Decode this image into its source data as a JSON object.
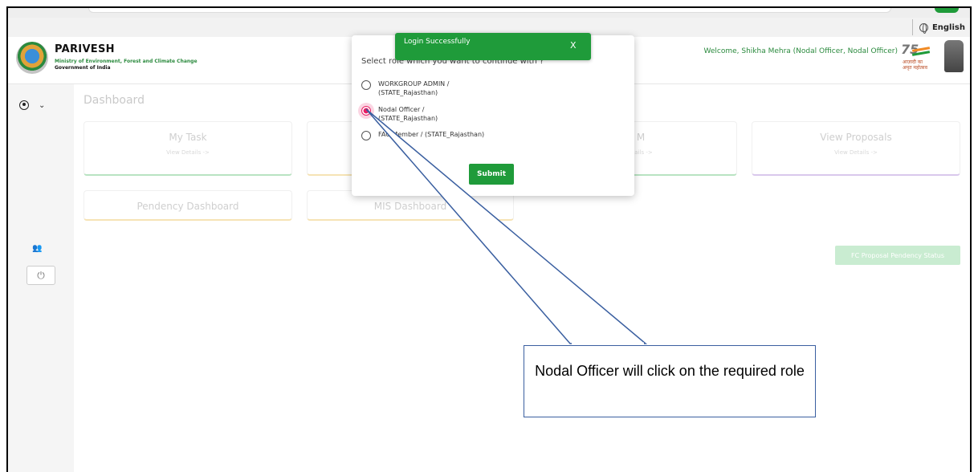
{
  "language": "English",
  "brand": {
    "name": "PARIVESH",
    "ministry": "Ministry of Environment, Forest and Climate Change",
    "government": "Government of India"
  },
  "header": {
    "welcome": "Welcome, Shikha Mehra (Nodal Officer, Nodal Officer)",
    "azadi_number": "75",
    "azadi_text_1": "आज़ादी का",
    "azadi_text_2": "अमृत महोत्सव"
  },
  "dashboard": {
    "title": "Dashboard",
    "cards": [
      {
        "title": "My Task",
        "link": "View Details ->"
      },
      {
        "title": "",
        "link": ""
      },
      {
        "title": "M",
        "link": "etails ->"
      },
      {
        "title": "View Proposals",
        "link": "View Details ->"
      }
    ],
    "pendency": "Pendency Dashboard",
    "card6": "MIS Dashboard",
    "pendency_button": "FC Proposal Pendency Status"
  },
  "modal": {
    "prompt": "Select role which you want to continue with ?",
    "options": [
      {
        "label": "WORKGROUP ADMIN /\n(STATE_Rajasthan)",
        "selected": false
      },
      {
        "label": "Nodal Officer /\n(STATE_Rajasthan)",
        "selected": true
      },
      {
        "label": "FAC Member / (STATE_Rajasthan)",
        "selected": false
      }
    ],
    "submit": "Submit"
  },
  "toast": {
    "message": "Login Successfully",
    "close": "X"
  },
  "callout": {
    "text": "Nodal Officer will click on the required role"
  },
  "colors": {
    "accent_green": "#1f9b3a",
    "selected_radio": "#e91e63",
    "callout_border": "#3a5fa0"
  }
}
